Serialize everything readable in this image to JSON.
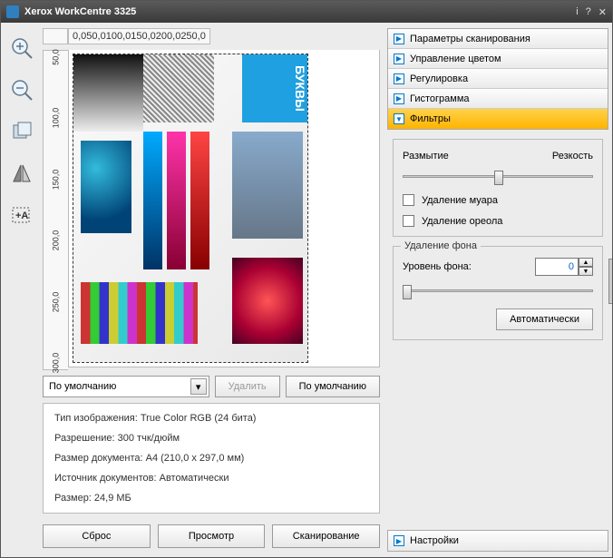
{
  "window": {
    "title": "Xerox WorkCentre 3325"
  },
  "ruler": {
    "h": [
      "0,0",
      "50,0",
      "100,0",
      "150,0",
      "200,0",
      "250,0"
    ],
    "v": [
      "50,0",
      "100,0",
      "150,0",
      "200,0",
      "250,0",
      "300,0"
    ]
  },
  "preset": {
    "combo": "По умолчанию",
    "delete": "Удалить",
    "default": "По умолчанию"
  },
  "info": {
    "l1": "Тип изображения: True Color RGB (24 бита)",
    "l2": "Разрешение: 300 тчк/дюйм",
    "l3": "Размер документа: A4 (210,0 x 297,0 мм)",
    "l4": "Источник документов: Автоматически",
    "l5": "Размер: 24,9 МБ"
  },
  "buttons": {
    "reset": "Сброс",
    "preview": "Просмотр",
    "scan": "Сканирование"
  },
  "accordion": {
    "i1": "Параметры сканирования",
    "i2": "Управление цветом",
    "i3": "Регулировка",
    "i4": "Гистограмма",
    "i5": "Фильтры",
    "footer": "Настройки"
  },
  "filters": {
    "blur": "Размытие",
    "sharp": "Резкость",
    "demoire": "Удаление муара",
    "dehalo": "Удаление ореола",
    "bgremoval_legend": "Удаление фона",
    "bglevel": "Уровень фона:",
    "bgvalue": "0",
    "auto": "Автоматически"
  }
}
